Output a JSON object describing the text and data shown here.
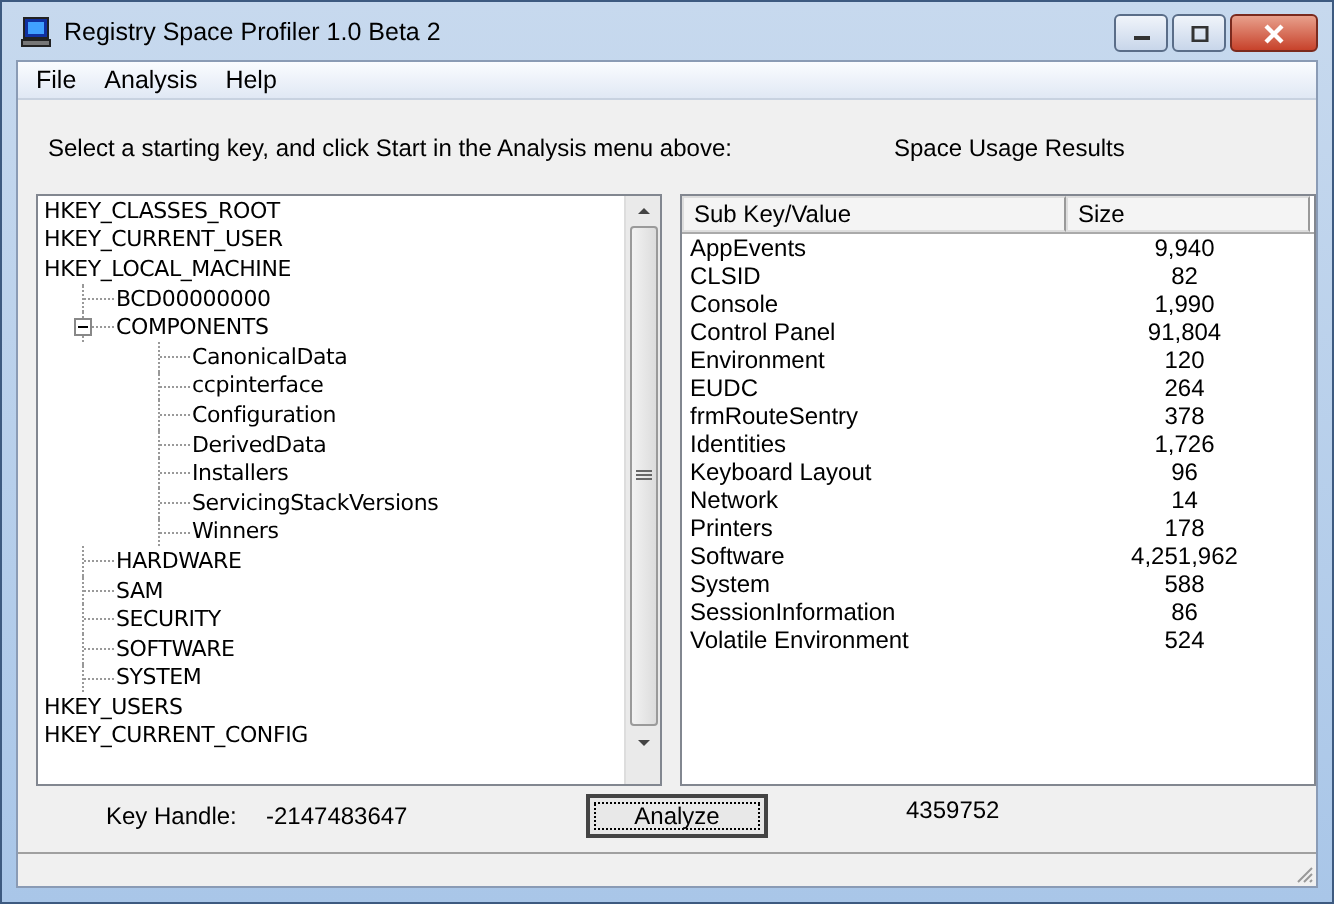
{
  "window": {
    "title": "Registry Space Profiler 1.0 Beta 2"
  },
  "menu": [
    "File",
    "Analysis",
    "Help"
  ],
  "instruction": "Select a starting key, and click Start in the Analysis menu above:",
  "results_label": "Space Usage Results",
  "tree": [
    {
      "label": "HKEY_CLASSES_ROOT"
    },
    {
      "label": "HKEY_CURRENT_USER"
    },
    {
      "label": "HKEY_LOCAL_MACHINE",
      "children": [
        {
          "label": "BCD00000000"
        },
        {
          "label": "COMPONENTS",
          "expanded": true,
          "children": [
            {
              "label": "CanonicalData"
            },
            {
              "label": "ccpinterface"
            },
            {
              "label": "Configuration"
            },
            {
              "label": "DerivedData"
            },
            {
              "label": "Installers"
            },
            {
              "label": "ServicingStackVersions"
            },
            {
              "label": "Winners"
            }
          ]
        },
        {
          "label": "HARDWARE"
        },
        {
          "label": "SAM"
        },
        {
          "label": "SECURITY"
        },
        {
          "label": "SOFTWARE"
        },
        {
          "label": "SYSTEM"
        }
      ]
    },
    {
      "label": "HKEY_USERS"
    },
    {
      "label": "HKEY_CURRENT_CONFIG"
    }
  ],
  "table": {
    "columns": [
      "Sub Key/Value",
      "Size"
    ],
    "rows": [
      [
        "AppEvents",
        "9,940"
      ],
      [
        "CLSID",
        "82"
      ],
      [
        "Console",
        "1,990"
      ],
      [
        "Control Panel",
        "91,804"
      ],
      [
        "Environment",
        "120"
      ],
      [
        "EUDC",
        "264"
      ],
      [
        "frmRouteSentry",
        "378"
      ],
      [
        "Identities",
        "1,726"
      ],
      [
        "Keyboard Layout",
        "96"
      ],
      [
        "Network",
        "14"
      ],
      [
        "Printers",
        "178"
      ],
      [
        "Software",
        "4,251,962"
      ],
      [
        "System",
        "588"
      ],
      [
        "SessionInformation",
        "86"
      ],
      [
        "Volatile Environment",
        "524"
      ]
    ]
  },
  "key_handle": {
    "label": "Key Handle:",
    "value": "-2147483647"
  },
  "analyze_button": "Analyze",
  "total": "4359752"
}
